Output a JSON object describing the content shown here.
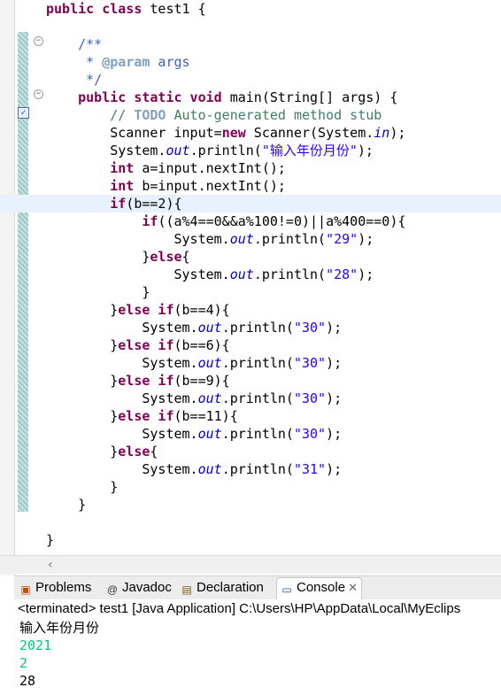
{
  "editor": {
    "lines": [
      [
        {
          "t": "public class ",
          "c": "kw"
        },
        {
          "t": "test1 {",
          "c": ""
        }
      ],
      [
        {
          "t": "",
          "c": ""
        }
      ],
      [
        {
          "t": "    /**",
          "c": "jd"
        }
      ],
      [
        {
          "t": "     * ",
          "c": "jd"
        },
        {
          "t": "@param",
          "c": "jt"
        },
        {
          "t": " args",
          "c": "jd"
        }
      ],
      [
        {
          "t": "     */",
          "c": "jd"
        }
      ],
      [
        {
          "t": "    ",
          "c": ""
        },
        {
          "t": "public static void ",
          "c": "kw"
        },
        {
          "t": "main(String[] args) {",
          "c": ""
        }
      ],
      [
        {
          "t": "        // ",
          "c": "cm"
        },
        {
          "t": "TODO",
          "c": "todo"
        },
        {
          "t": " Auto-generated method stub",
          "c": "cm"
        }
      ],
      [
        {
          "t": "        Scanner input=",
          "c": ""
        },
        {
          "t": "new",
          "c": "kw"
        },
        {
          "t": " Scanner(System.",
          "c": ""
        },
        {
          "t": "in",
          "c": "fld"
        },
        {
          "t": ");",
          "c": ""
        }
      ],
      [
        {
          "t": "        System.",
          "c": ""
        },
        {
          "t": "out",
          "c": "fld"
        },
        {
          "t": ".println(",
          "c": ""
        },
        {
          "t": "\"输入年份月份\"",
          "c": "str"
        },
        {
          "t": ");",
          "c": ""
        }
      ],
      [
        {
          "t": "        ",
          "c": ""
        },
        {
          "t": "int",
          "c": "kw"
        },
        {
          "t": " a=input.nextInt();",
          "c": ""
        }
      ],
      [
        {
          "t": "        ",
          "c": ""
        },
        {
          "t": "int",
          "c": "kw"
        },
        {
          "t": " b=input.nextInt();",
          "c": ""
        }
      ],
      [
        {
          "t": "        ",
          "c": ""
        },
        {
          "t": "if",
          "c": "kw"
        },
        {
          "t": "(b==2){",
          "c": ""
        }
      ],
      [
        {
          "t": "            ",
          "c": ""
        },
        {
          "t": "if",
          "c": "kw"
        },
        {
          "t": "((a%4==0&&a%100!=0)||a%400==0){",
          "c": ""
        }
      ],
      [
        {
          "t": "                System.",
          "c": ""
        },
        {
          "t": "out",
          "c": "fld"
        },
        {
          "t": ".println(",
          "c": ""
        },
        {
          "t": "\"29\"",
          "c": "str"
        },
        {
          "t": ");",
          "c": ""
        }
      ],
      [
        {
          "t": "            }",
          "c": ""
        },
        {
          "t": "else",
          "c": "kw"
        },
        {
          "t": "{",
          "c": ""
        }
      ],
      [
        {
          "t": "                System.",
          "c": ""
        },
        {
          "t": "out",
          "c": "fld"
        },
        {
          "t": ".println(",
          "c": ""
        },
        {
          "t": "\"28\"",
          "c": "str"
        },
        {
          "t": ");",
          "c": ""
        }
      ],
      [
        {
          "t": "            }",
          "c": ""
        }
      ],
      [
        {
          "t": "        }",
          "c": ""
        },
        {
          "t": "else if",
          "c": "kw"
        },
        {
          "t": "(b==4){",
          "c": ""
        }
      ],
      [
        {
          "t": "            System.",
          "c": ""
        },
        {
          "t": "out",
          "c": "fld"
        },
        {
          "t": ".println(",
          "c": ""
        },
        {
          "t": "\"30\"",
          "c": "str"
        },
        {
          "t": ");",
          "c": ""
        }
      ],
      [
        {
          "t": "        }",
          "c": ""
        },
        {
          "t": "else if",
          "c": "kw"
        },
        {
          "t": "(b==6){",
          "c": ""
        }
      ],
      [
        {
          "t": "            System.",
          "c": ""
        },
        {
          "t": "out",
          "c": "fld"
        },
        {
          "t": ".println(",
          "c": ""
        },
        {
          "t": "\"30\"",
          "c": "str"
        },
        {
          "t": ");",
          "c": ""
        }
      ],
      [
        {
          "t": "        }",
          "c": ""
        },
        {
          "t": "else if",
          "c": "kw"
        },
        {
          "t": "(b==9){",
          "c": ""
        }
      ],
      [
        {
          "t": "            System.",
          "c": ""
        },
        {
          "t": "out",
          "c": "fld"
        },
        {
          "t": ".println(",
          "c": ""
        },
        {
          "t": "\"30\"",
          "c": "str"
        },
        {
          "t": ");",
          "c": ""
        }
      ],
      [
        {
          "t": "        }",
          "c": ""
        },
        {
          "t": "else if",
          "c": "kw"
        },
        {
          "t": "(b==11){",
          "c": ""
        }
      ],
      [
        {
          "t": "            System.",
          "c": ""
        },
        {
          "t": "out",
          "c": "fld"
        },
        {
          "t": ".println(",
          "c": ""
        },
        {
          "t": "\"30\"",
          "c": "str"
        },
        {
          "t": ");",
          "c": ""
        }
      ],
      [
        {
          "t": "        }",
          "c": ""
        },
        {
          "t": "else",
          "c": "kw"
        },
        {
          "t": "{",
          "c": ""
        }
      ],
      [
        {
          "t": "            System.",
          "c": ""
        },
        {
          "t": "out",
          "c": "fld"
        },
        {
          "t": ".println(",
          "c": ""
        },
        {
          "t": "\"31\"",
          "c": "str"
        },
        {
          "t": ");",
          "c": ""
        }
      ],
      [
        {
          "t": "        }",
          "c": ""
        }
      ],
      [
        {
          "t": "    }",
          "c": ""
        }
      ],
      [
        {
          "t": "",
          "c": ""
        }
      ],
      [
        {
          "t": "}",
          "c": ""
        }
      ]
    ],
    "current_line": 11
  },
  "views": {
    "tabs": [
      {
        "label": "Problems",
        "icon": "problems-icon"
      },
      {
        "label": "Javadoc",
        "icon": "javadoc-icon"
      },
      {
        "label": "Declaration",
        "icon": "declaration-icon"
      },
      {
        "label": "Console",
        "icon": "console-icon",
        "active": true
      }
    ],
    "console": {
      "terminated": "<terminated> test1 [Java Application] C:\\Users\\HP\\AppData\\Local\\MyEclips",
      "output": [
        {
          "text": "输入年份月份",
          "type": "out"
        },
        {
          "text": "2021",
          "type": "in"
        },
        {
          "text": "2",
          "type": "in"
        },
        {
          "text": "28",
          "type": "out"
        }
      ]
    }
  },
  "colors": {
    "keyword": "#7f0055",
    "string": "#2a00ff",
    "comment": "#3f7f5f",
    "javadoc": "#3f5fbf",
    "field": "#0000c0",
    "stdin": "#00c87d"
  }
}
